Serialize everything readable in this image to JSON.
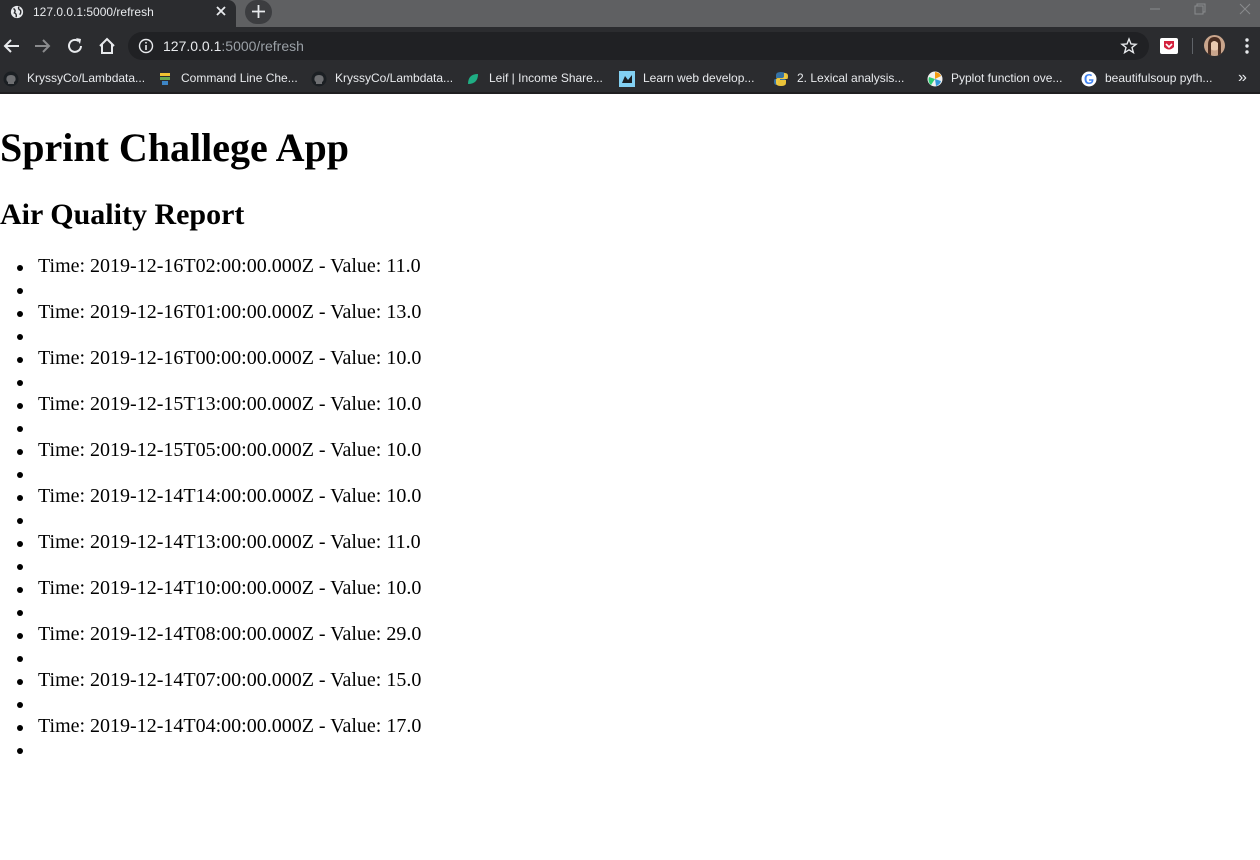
{
  "browser": {
    "tab_title": "127.0.0.1:5000/refresh",
    "url_host": "127.0.0.1",
    "url_rest": ":5000/refresh",
    "bookmarks": [
      {
        "label": "KryssyCo/Lambdata...",
        "icon": "github-icon"
      },
      {
        "label": "Command Line Che...",
        "icon": "bookmark-site-icon"
      },
      {
        "label": "KryssyCo/Lambdata...",
        "icon": "github-icon"
      },
      {
        "label": "Leif | Income Share...",
        "icon": "leif-icon"
      },
      {
        "label": "Learn web develop...",
        "icon": "mdn-icon"
      },
      {
        "label": "2. Lexical analysis...",
        "icon": "python-icon"
      },
      {
        "label": "Pyplot function ove...",
        "icon": "matplotlib-icon"
      },
      {
        "label": "beautifulsoup pyth...",
        "icon": "google-icon"
      }
    ],
    "more_bookmarks": "»"
  },
  "page": {
    "title": "Sprint Challege App",
    "subtitle": "Air Quality Report",
    "items": [
      "Time: 2019-12-16T02:00:00.000Z - Value: 11.0",
      "",
      "Time: 2019-12-16T01:00:00.000Z - Value: 13.0",
      "",
      "Time: 2019-12-16T00:00:00.000Z - Value: 10.0",
      "",
      "Time: 2019-12-15T13:00:00.000Z - Value: 10.0",
      "",
      "Time: 2019-12-15T05:00:00.000Z - Value: 10.0",
      "",
      "Time: 2019-12-14T14:00:00.000Z - Value: 10.0",
      "",
      "Time: 2019-12-14T13:00:00.000Z - Value: 11.0",
      "",
      "Time: 2019-12-14T10:00:00.000Z - Value: 10.0",
      "",
      "Time: 2019-12-14T08:00:00.000Z - Value: 29.0",
      "",
      "Time: 2019-12-14T07:00:00.000Z - Value: 15.0",
      "",
      "Time: 2019-12-14T04:00:00.000Z - Value: 17.0",
      ""
    ]
  }
}
